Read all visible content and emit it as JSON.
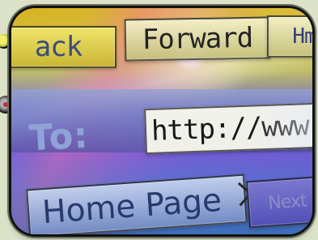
{
  "browser_toolbar": {
    "back_label": "ack",
    "forward_label": "Forward",
    "next_label": "Hm"
  },
  "address_bar": {
    "label": "To:",
    "value": "http://www"
  },
  "home_page": {
    "label": "Home Page",
    "next_button_label": "Next"
  },
  "colors": {
    "frame": "#111111",
    "yellow_button": "#d6b21f",
    "purple_background": "#6b4fd0",
    "blue_background": "#4a74c9"
  },
  "icons": [
    "left-edge-yellow-dot-icon",
    "left-edge-red-dot-icon",
    "chevron-right-icon"
  ]
}
